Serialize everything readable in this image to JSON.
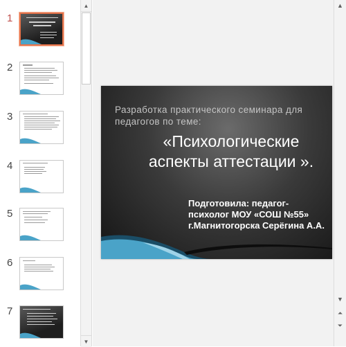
{
  "thumbnails": [
    {
      "number": "1",
      "style": "dark",
      "selected": true
    },
    {
      "number": "2",
      "style": "light",
      "selected": false
    },
    {
      "number": "3",
      "style": "light",
      "selected": false
    },
    {
      "number": "4",
      "style": "light",
      "selected": false
    },
    {
      "number": "5",
      "style": "light",
      "selected": false
    },
    {
      "number": "6",
      "style": "light",
      "selected": false
    },
    {
      "number": "7",
      "style": "dark",
      "selected": false
    }
  ],
  "slide": {
    "subtitle": "Разработка практического семинара для педагогов по теме:",
    "title": "«Психологические аспекты аттестации ».",
    "author": "Подготовила: педагог-психолог МОУ «СОШ №55» г.Магнитогорска Серёгина А.А."
  },
  "colors": {
    "selection_accent": "#e8734a",
    "slide_background": "#2e2e2e",
    "wave_blue": "#4aa3c8",
    "text_white": "#ffffff"
  },
  "icons": {
    "scroll_up": "▲",
    "scroll_down": "▼",
    "prev_slide": "⏶",
    "next_slide": "⏷"
  }
}
